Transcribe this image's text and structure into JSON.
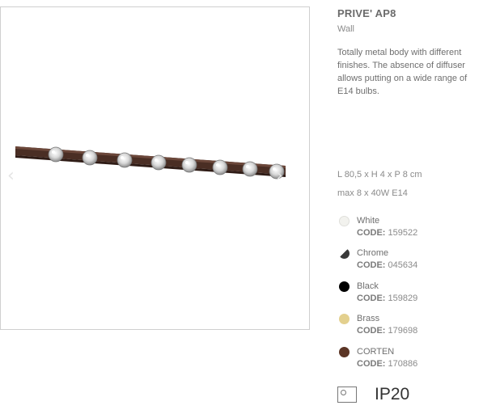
{
  "product": {
    "title": "PRIVE' AP8",
    "category": "Wall",
    "description": "Totally metal body with different finishes. The absence of diffuser allows putting on a wide range of E14 bulbs.",
    "dimensions": "L 80,5 x H 4 x P 8 cm",
    "bulb_spec": "max 8 x 40W E14",
    "ip_rating": "IP20"
  },
  "gallery": {
    "prev_icon": "‹",
    "next_icon": "›"
  },
  "finishes": [
    {
      "name": "White",
      "code_label": "CODE:",
      "code": "159522",
      "color": "#f2f2ee"
    },
    {
      "name": "Chrome",
      "code_label": "CODE:",
      "code": "045634",
      "color": "#3a3a3a"
    },
    {
      "name": "Black",
      "code_label": "CODE:",
      "code": "159829",
      "color": "#000000"
    },
    {
      "name": "Brass",
      "code_label": "CODE:",
      "code": "179698",
      "color": "#e3d08e"
    },
    {
      "name": "CORTEN",
      "code_label": "CODE:",
      "code": "170886",
      "color": "#5b3525"
    }
  ]
}
